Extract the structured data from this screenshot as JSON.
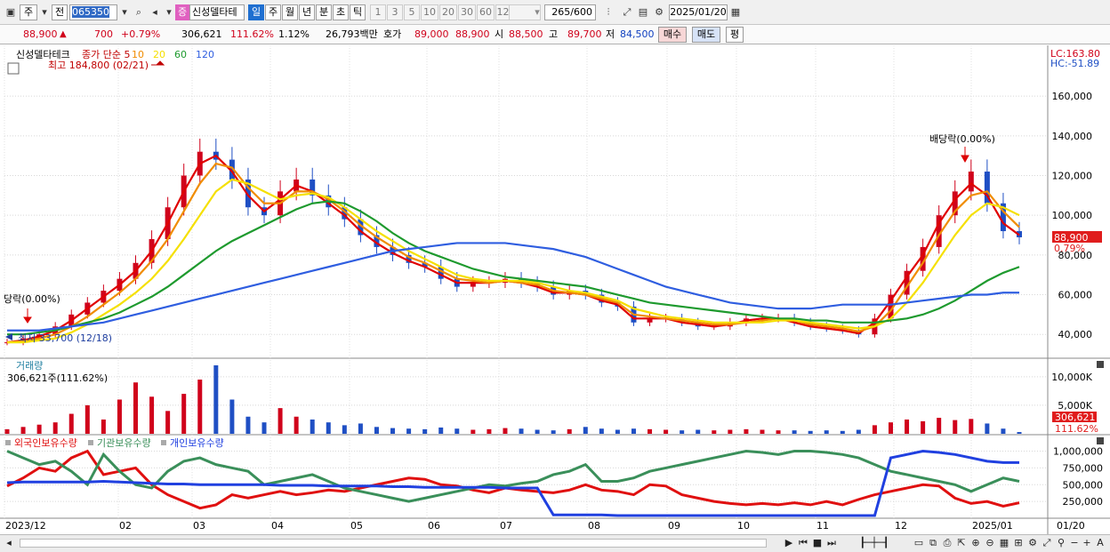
{
  "toolbar": {
    "market_label": "주",
    "prev_label": "전",
    "code": "065350",
    "stock_badge": "증",
    "stock_name": "신성델타테",
    "periods": [
      "일",
      "주",
      "월",
      "년",
      "분",
      "초",
      "틱"
    ],
    "selected_period": "일",
    "intervals": [
      "1",
      "3",
      "5",
      "10",
      "20",
      "30",
      "60",
      "120"
    ],
    "count_value": "265",
    "count_total": "/600",
    "date": "2025/01/20"
  },
  "quote": {
    "price": "88,900",
    "change": "700",
    "change_pct": "+0.79%",
    "volume": "306,621",
    "volume_ratio": "111.62%",
    "turnover": "1.12%",
    "amount": "26,793백만",
    "bid_label": "호가",
    "ask": "89,000",
    "bid": "88,900",
    "open_label": "시",
    "open": "88,500",
    "high_label": "고",
    "high": "89,700",
    "low_label": "저",
    "low": "84,500",
    "buy_label": "매수",
    "sell_label": "매도",
    "eval_label": "평"
  },
  "status": {
    "zoom_minus": "−",
    "zoom_plus": "+",
    "font_label": "A"
  },
  "colors": {
    "up": "#d0021b",
    "down": "#1f4fc4",
    "ma5": "#e00000",
    "ma10": "#f08c00",
    "ma20": "#f5e000",
    "ma60": "#1e9a2e",
    "ma120": "#2f5ee0",
    "foreign": "#e01010",
    "institution": "#3a8f5a",
    "individual": "#2040e0"
  },
  "chart_data": [
    {
      "type": "candlestick",
      "panel": "price",
      "title": "신성델타테크",
      "legend": [
        "종가 단순 5",
        "10",
        "20",
        "60",
        "120"
      ],
      "y_ticks": [
        "40,000",
        "60,000",
        "80,000",
        "100,000",
        "120,000",
        "140,000",
        "160,000"
      ],
      "ylim": [
        28000,
        182000
      ],
      "x_ticks": [
        "2023/12",
        "02",
        "03",
        "04",
        "05",
        "06",
        "07",
        "08",
        "09",
        "10",
        "11",
        "12",
        "2025/01",
        "01/20"
      ],
      "lc_label": "LC:163.80",
      "hc_label": "HC:-51.89",
      "high_marker": "최고 184,800 (02/21)",
      "low_marker": "최저 33,700 (12/18)",
      "dividend_left": "당락(0.00%)",
      "dividend_right": "배당락(0.00%)",
      "last_price": "88,900",
      "last_pct": "0.79%",
      "close_series": [
        {
          "name": "종가",
          "values": [
            36000,
            38000,
            40000,
            44000,
            50000,
            56000,
            62000,
            68000,
            76000,
            88000,
            104000,
            120000,
            132000,
            128000,
            118000,
            104000,
            100000,
            112000,
            118000,
            110000,
            104000,
            98000,
            90000,
            84000,
            80000,
            76000,
            74000,
            68000,
            64000,
            66000,
            66000,
            68000,
            66000,
            64000,
            60000,
            62000,
            60000,
            56000,
            54000,
            46000,
            48000,
            48000,
            46000,
            44000,
            44000,
            46000,
            48000,
            48000,
            48000,
            46000,
            44000,
            43000,
            42000,
            40000,
            48000,
            60000,
            72000,
            84000,
            100000,
            112000,
            122000,
            106000,
            92000,
            88900
          ]
        }
      ],
      "ma_series": [
        {
          "name": "5",
          "values": [
            36000,
            37000,
            39000,
            42000,
            47000,
            53000,
            59000,
            65000,
            72000,
            82000,
            96000,
            112000,
            126000,
            130000,
            122000,
            110000,
            102000,
            108000,
            115000,
            112000,
            106000,
            100000,
            92000,
            86000,
            81000,
            77000,
            74000,
            70000,
            66000,
            66000,
            66000,
            67000,
            66000,
            64000,
            61000,
            61000,
            60000,
            57000,
            55000,
            48000,
            48000,
            48000,
            46000,
            45000,
            44000,
            45000,
            47000,
            48000,
            48000,
            46000,
            44000,
            43000,
            42000,
            40500,
            46000,
            57000,
            69000,
            80000,
            96000,
            108000,
            116000,
            110000,
            96000,
            90000
          ]
        },
        {
          "name": "10",
          "values": [
            36000,
            36500,
            38000,
            40000,
            44000,
            49000,
            55000,
            61000,
            68000,
            77000,
            88000,
            102000,
            116000,
            126000,
            124000,
            114000,
            106000,
            106000,
            112000,
            112000,
            108000,
            102000,
            95000,
            89000,
            84000,
            79000,
            76000,
            72000,
            68000,
            67000,
            66000,
            67000,
            66000,
            65000,
            62000,
            61000,
            60000,
            58000,
            56000,
            50000,
            49000,
            48000,
            47000,
            46000,
            45000,
            45000,
            46000,
            47000,
            48000,
            47000,
            45000,
            44000,
            43000,
            41500,
            44000,
            52000,
            64000,
            76000,
            90000,
            102000,
            110000,
            112000,
            102000,
            94000
          ]
        },
        {
          "name": "20",
          "values": [
            36000,
            36000,
            37000,
            38000,
            41000,
            45000,
            50000,
            55000,
            61000,
            68000,
            77000,
            88000,
            100000,
            112000,
            118000,
            116000,
            112000,
            108000,
            110000,
            111000,
            109000,
            104000,
            98000,
            92000,
            87000,
            82000,
            78000,
            74000,
            70000,
            68000,
            67000,
            67000,
            67000,
            66000,
            64000,
            62000,
            61000,
            59000,
            57000,
            53000,
            51000,
            49000,
            48000,
            47000,
            46000,
            46000,
            46000,
            46000,
            47000,
            47000,
            46000,
            45000,
            44000,
            43000,
            44000,
            48000,
            56000,
            66000,
            78000,
            90000,
            100000,
            106000,
            104000,
            100000
          ]
        },
        {
          "name": "60",
          "values": [
            40000,
            40000,
            41000,
            42000,
            44000,
            46000,
            48000,
            51000,
            55000,
            59000,
            64000,
            70000,
            76000,
            82000,
            87000,
            91000,
            95000,
            99000,
            103000,
            106000,
            107000,
            106000,
            102000,
            97000,
            91000,
            86000,
            82000,
            79000,
            76000,
            73000,
            71000,
            69000,
            68000,
            67000,
            66000,
            65000,
            64000,
            62000,
            60000,
            58000,
            56000,
            55000,
            54000,
            53000,
            52000,
            51000,
            50000,
            49000,
            48000,
            48000,
            47000,
            47000,
            46000,
            46000,
            46000,
            47000,
            48000,
            50000,
            53000,
            57000,
            62000,
            67000,
            71000,
            74000
          ]
        },
        {
          "name": "120",
          "values": [
            42000,
            42000,
            42000,
            43000,
            44000,
            45000,
            46000,
            48000,
            50000,
            52000,
            54000,
            56000,
            58000,
            60000,
            62000,
            64000,
            66000,
            68000,
            70000,
            72000,
            74000,
            76000,
            78000,
            80000,
            82000,
            83000,
            84000,
            85000,
            86000,
            86000,
            86000,
            86000,
            85000,
            84000,
            83000,
            81000,
            79000,
            76000,
            73000,
            70000,
            67000,
            64000,
            62000,
            60000,
            58000,
            56000,
            55000,
            54000,
            53000,
            53000,
            53000,
            54000,
            55000,
            55000,
            55000,
            55000,
            56000,
            57000,
            58000,
            59000,
            60000,
            60000,
            61000,
            61000
          ]
        }
      ]
    },
    {
      "type": "bar",
      "panel": "volume",
      "title": "거래량",
      "readout": "306,621주(111.62%)",
      "y_ticks": [
        "5,000K",
        "10,000K"
      ],
      "ylim": [
        0,
        12000000
      ],
      "last_label": "306,621",
      "last_pct": "111.62%",
      "values": [
        800000,
        1200000,
        1600000,
        2000000,
        3500000,
        5000000,
        2500000,
        6000000,
        9000000,
        6500000,
        4000000,
        7000000,
        9500000,
        12000000,
        6000000,
        3000000,
        2000000,
        4500000,
        3000000,
        2500000,
        2000000,
        1500000,
        1800000,
        1200000,
        1000000,
        900000,
        800000,
        1100000,
        900000,
        700000,
        800000,
        1000000,
        900000,
        700000,
        600000,
        800000,
        1200000,
        900000,
        700000,
        900000,
        800000,
        700000,
        600000,
        700000,
        600000,
        700000,
        800000,
        700000,
        600000,
        600000,
        500000,
        600000,
        500000,
        700000,
        1500000,
        2000000,
        2500000,
        2200000,
        2800000,
        2400000,
        2600000,
        1800000,
        900000,
        306621
      ]
    },
    {
      "type": "line",
      "panel": "holdings",
      "series_names": [
        "외국인보유수량",
        "기관보유수량",
        "개인보유수량"
      ],
      "y_ticks": [
        "250,000",
        "500,000",
        "750,000",
        "1,000,000"
      ],
      "ylim": [
        0,
        1100000
      ],
      "series": [
        {
          "name": "외국인보유수량",
          "values": [
            480000,
            600000,
            750000,
            700000,
            900000,
            1000000,
            650000,
            700000,
            750000,
            500000,
            350000,
            250000,
            150000,
            200000,
            350000,
            300000,
            350000,
            400000,
            350000,
            380000,
            420000,
            400000,
            450000,
            500000,
            550000,
            600000,
            580000,
            500000,
            480000,
            420000,
            380000,
            450000,
            420000,
            400000,
            380000,
            420000,
            500000,
            420000,
            400000,
            350000,
            500000,
            480000,
            350000,
            300000,
            250000,
            220000,
            200000,
            220000,
            200000,
            230000,
            200000,
            250000,
            200000,
            280000,
            350000,
            400000,
            450000,
            500000,
            480000,
            300000,
            220000,
            250000,
            180000,
            230000
          ]
        },
        {
          "name": "기관보유수량",
          "values": [
            1000000,
            900000,
            800000,
            850000,
            700000,
            500000,
            950000,
            700000,
            500000,
            450000,
            700000,
            850000,
            900000,
            800000,
            750000,
            700000,
            500000,
            550000,
            600000,
            650000,
            550000,
            450000,
            400000,
            350000,
            300000,
            250000,
            300000,
            350000,
            400000,
            450000,
            500000,
            480000,
            520000,
            550000,
            650000,
            700000,
            800000,
            550000,
            550000,
            600000,
            700000,
            750000,
            800000,
            850000,
            900000,
            950000,
            1000000,
            980000,
            950000,
            1000000,
            1000000,
            980000,
            950000,
            900000,
            800000,
            700000,
            650000,
            600000,
            550000,
            500000,
            400000,
            500000,
            600000,
            550000
          ]
        },
        {
          "name": "개인보유수량",
          "values": [
            530000,
            540000,
            540000,
            540000,
            540000,
            540000,
            550000,
            540000,
            530000,
            520000,
            510000,
            510000,
            500000,
            500000,
            500000,
            500000,
            500000,
            490000,
            490000,
            490000,
            480000,
            480000,
            480000,
            480000,
            470000,
            470000,
            460000,
            460000,
            460000,
            460000,
            460000,
            450000,
            450000,
            450000,
            50000,
            50000,
            50000,
            50000,
            40000,
            40000,
            40000,
            40000,
            40000,
            40000,
            40000,
            40000,
            40000,
            40000,
            40000,
            40000,
            40000,
            40000,
            40000,
            40000,
            40000,
            900000,
            950000,
            1000000,
            980000,
            950000,
            900000,
            850000,
            830000,
            830000
          ]
        }
      ]
    }
  ]
}
